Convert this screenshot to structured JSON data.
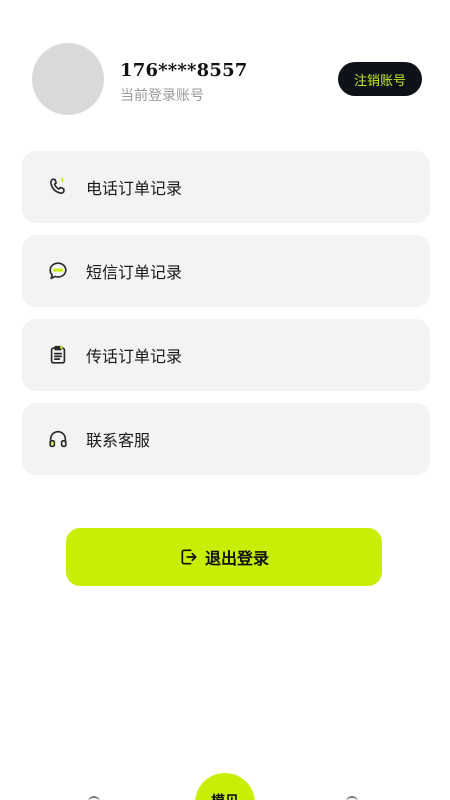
{
  "profile": {
    "phone": "176****8557",
    "subtitle": "当前登录账号",
    "cancel_label": "注销账号"
  },
  "menu": {
    "items": [
      {
        "label": "电话订单记录",
        "icon": "phone-icon"
      },
      {
        "label": "短信订单记录",
        "icon": "message-icon"
      },
      {
        "label": "传话订单记录",
        "icon": "clipboard-icon"
      },
      {
        "label": "联系客服",
        "icon": "headset-icon"
      }
    ]
  },
  "logout": {
    "label": "退出登录",
    "icon": "logout-icon"
  },
  "tabbar": {
    "center_label": "模见"
  },
  "colors": {
    "accent": "#c6ef05",
    "dark_button": "#0f1119",
    "dark_button_text": "#c6ea2d",
    "card_bg": "#f3f3f3",
    "avatar_bg": "#d9d9d9"
  }
}
